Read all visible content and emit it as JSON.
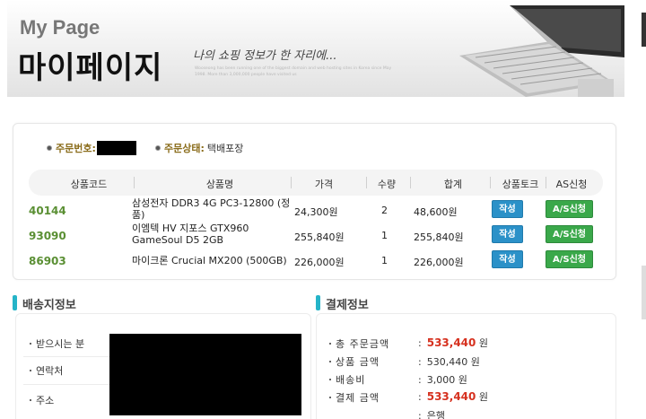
{
  "banner": {
    "title_en": "My Page",
    "title_ko": "마이페이지",
    "slogan": "나의 쇼핑 정보가 한 자리에...",
    "fineprint": "Wooseong has been running one of the biggest domain and web hosting sites in Korea since May 1998. More than 3,000,000 people have visited us"
  },
  "order": {
    "order_no_label": "주문번호:",
    "status_label": "주문상태:",
    "status_value": "택배포장",
    "headers": [
      "상품코드",
      "상품명",
      "가격",
      "수량",
      "합계",
      "상품토크",
      "AS신청"
    ],
    "rows": [
      {
        "code": "40144",
        "name_line1": "삼성전자 DDR3 4G PC3-12800 (정",
        "name_line2": "품)",
        "price": "24,300원",
        "qty": "2",
        "total": "48,600원",
        "talk_btn": "작성",
        "as_btn": "A/S신청"
      },
      {
        "code": "93090",
        "name_line1": "이엠텍 HV 지포스 GTX960",
        "name_line2": "GameSoul D5 2GB",
        "price": "255,840원",
        "qty": "1",
        "total": "255,840원",
        "talk_btn": "작성",
        "as_btn": "A/S신청"
      },
      {
        "code": "86903",
        "name_line1": "마이크론 Crucial MX200 (500GB)",
        "name_line2": "",
        "price": "226,000원",
        "qty": "1",
        "total": "226,000원",
        "talk_btn": "작성",
        "as_btn": "A/S신청"
      }
    ]
  },
  "shipping": {
    "title": "배송지정보",
    "labels": [
      "받으시는 분",
      "연락처",
      "주소"
    ]
  },
  "payment": {
    "title": "결제정보",
    "items": [
      {
        "label": "총 주문금액",
        "value": "533,440",
        "unit": "원"
      },
      {
        "label": "상품 금액",
        "value": "530,440",
        "unit": "원"
      },
      {
        "label": "배송비",
        "value": "3,000",
        "unit": "원"
      },
      {
        "label": "결제 금액",
        "value": "533,440",
        "unit": "원"
      },
      {
        "label": "",
        "value": "은행",
        "unit": ""
      }
    ],
    "accent_color": "#d6311f"
  }
}
